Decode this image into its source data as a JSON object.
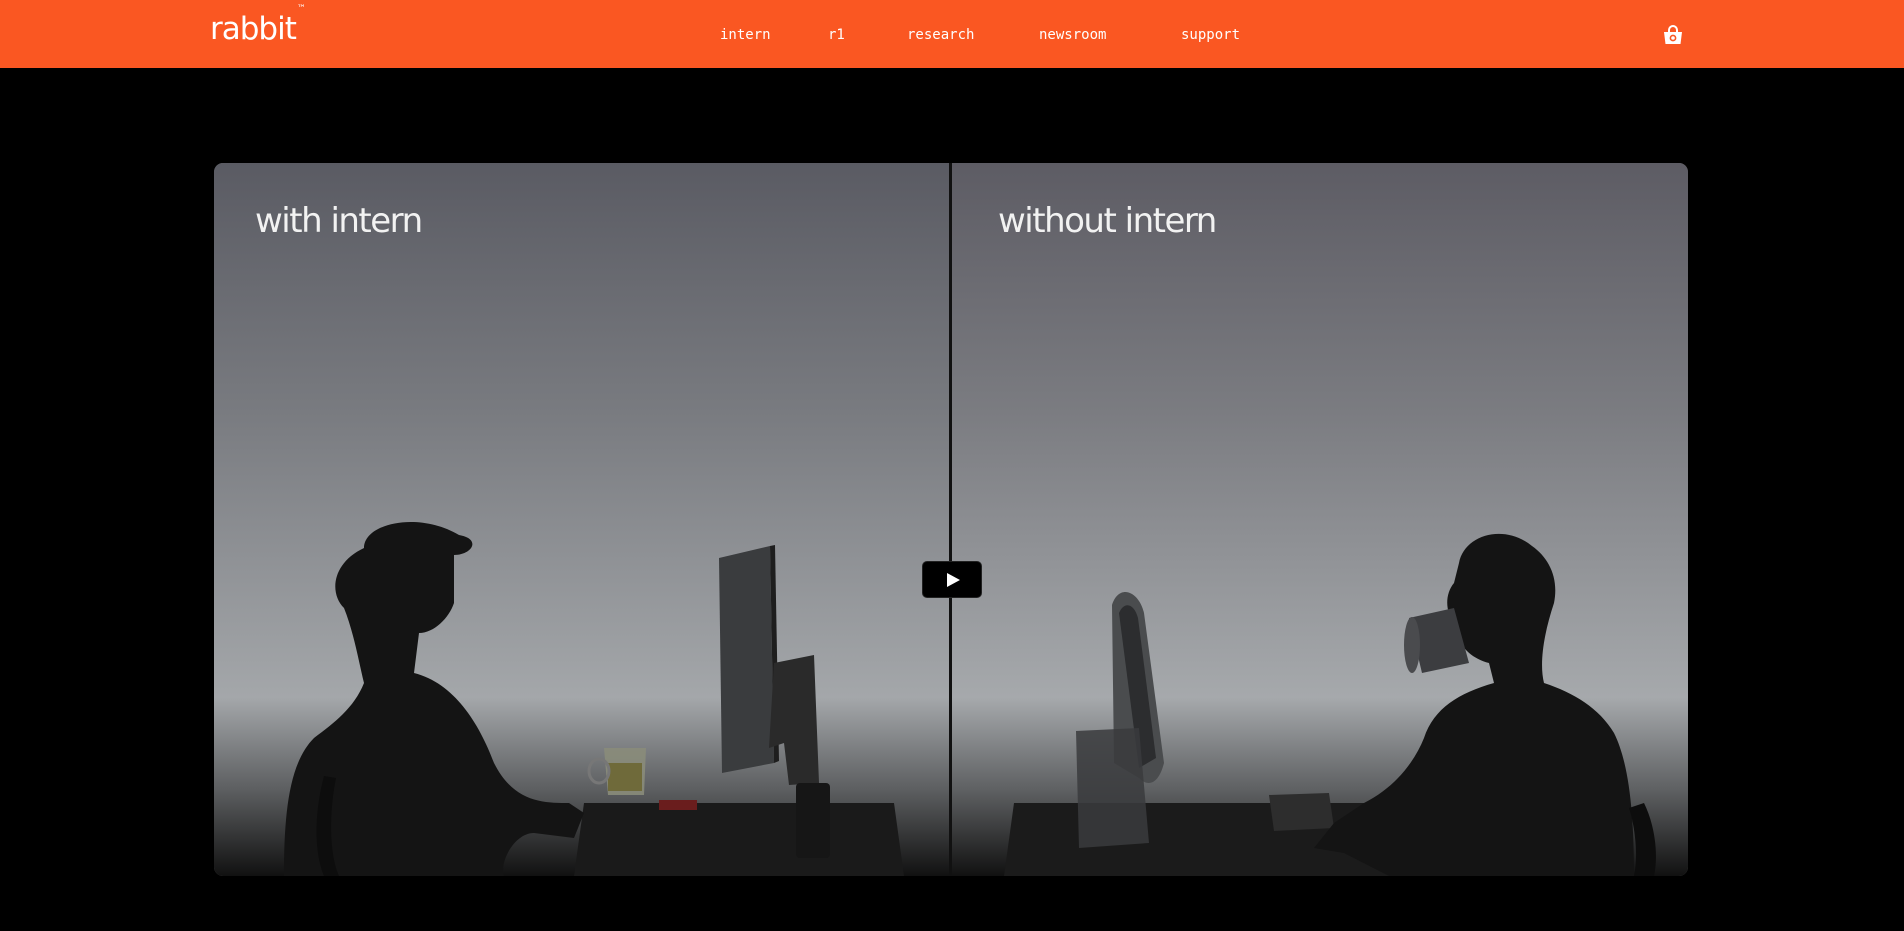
{
  "header": {
    "brand": "rabbit",
    "brand_mark": "™",
    "nav": [
      {
        "label": "intern"
      },
      {
        "label": "r1"
      },
      {
        "label": "research"
      },
      {
        "label": "newsroom"
      },
      {
        "label": "support"
      }
    ],
    "cart_icon": "shopping-bag-icon"
  },
  "video": {
    "left_caption": "with intern",
    "right_caption": "without intern",
    "play_icon": "play-icon"
  },
  "colors": {
    "brand_orange": "#fa5722",
    "background": "#000000",
    "text": "#ffffff"
  }
}
